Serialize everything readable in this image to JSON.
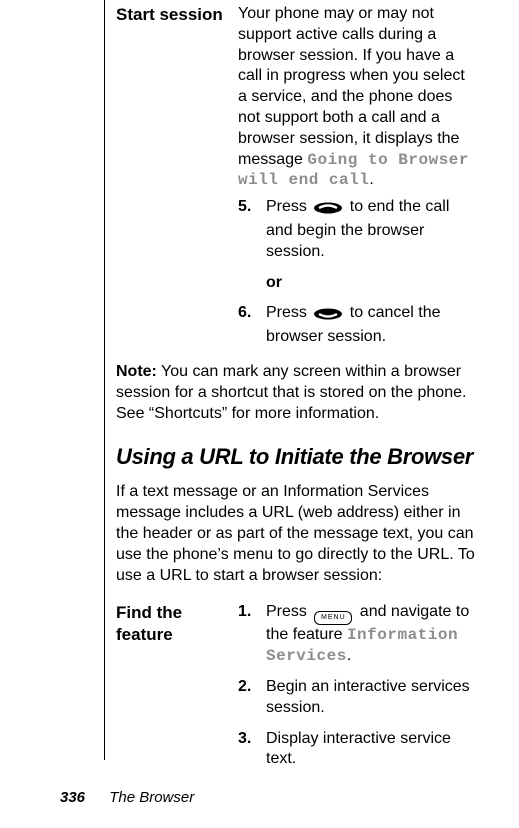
{
  "section1": {
    "label": "Start session",
    "intro_part1": "Your phone may or may not support active calls during a browser session. If you have a call in progress when you select a service, and the phone does not support both a call and a browser session, it displays the message ",
    "intro_code": "Going to Browser will end call",
    "intro_part2": ".",
    "step5": {
      "num": "5.",
      "before": "Press ",
      "after": " to end the call and begin the browser session."
    },
    "or": "or",
    "step6": {
      "num": "6.",
      "before": "Press ",
      "after": " to cancel the browser session."
    }
  },
  "note": {
    "label": "Note:",
    "text": " You can mark any screen within a browser session for a shortcut that is stored on the phone. See “Shortcuts” for more information."
  },
  "heading": "Using a URL to Initiate the Browser",
  "intro2": "If a text message or an Information Services message includes a URL (web address) either in the header or as part of the message text, you can use the phone’s menu to go directly to the URL. To use a URL to start a browser session:",
  "section2": {
    "label": "Find the feature",
    "step1": {
      "num": "1.",
      "before": "Press ",
      "after": " and navigate to the feature ",
      "code": "Information Services",
      "tail": "."
    },
    "step2": {
      "num": "2.",
      "text": "Begin an interactive services session."
    },
    "step3": {
      "num": "3.",
      "text": "Display interactive service text."
    }
  },
  "menu_key_label": "MENU",
  "footer": {
    "page": "336",
    "chapter": "The Browser"
  }
}
